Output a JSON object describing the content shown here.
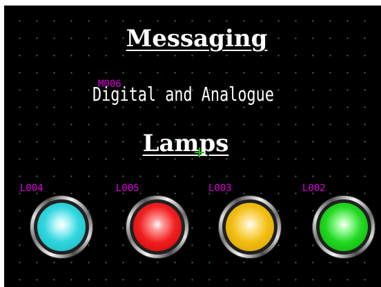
{
  "screen": {
    "title": "Messaging",
    "message_tag": "M006",
    "message_text": "Digital and Analogue",
    "lamps_title": "Lamps"
  },
  "lamps": [
    {
      "tag": "L004",
      "color": "cyan",
      "hex": "#33d6de"
    },
    {
      "tag": "L005",
      "color": "red",
      "hex": "#f02020"
    },
    {
      "tag": "L003",
      "color": "yellow",
      "hex": "#f1be12"
    },
    {
      "tag": "L002",
      "color": "green",
      "hex": "#22d822"
    }
  ],
  "colors": {
    "background": "#000000",
    "grid_dots": "#2f8a2f",
    "tag_text": "#e000e0",
    "title_text": "#ffffff",
    "cursor": "#19c419"
  }
}
